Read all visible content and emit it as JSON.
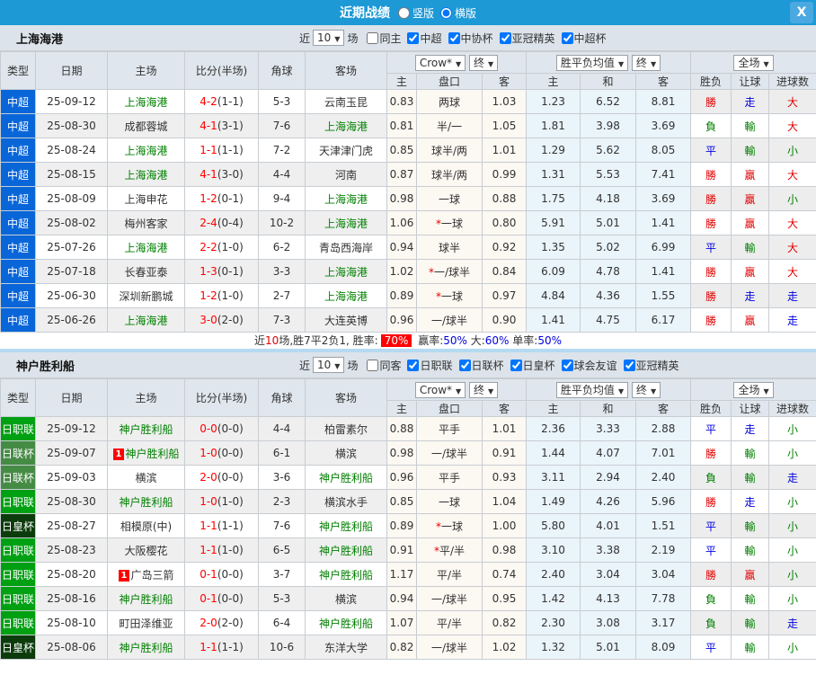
{
  "titlebar": {
    "title": "近期战绩",
    "view_options": [
      {
        "label": "竖版",
        "checked": false
      },
      {
        "label": "横版",
        "checked": true
      }
    ],
    "close_label": "X"
  },
  "filter": {
    "near_label": "近",
    "count": "10",
    "games_label": "场"
  },
  "table_header": {
    "main_columns": [
      "类型",
      "日期",
      "主场",
      "比分(半场)",
      "角球",
      "客场"
    ],
    "odds_source_select": "Crow*",
    "odds_time_select": "终",
    "avg_select": "胜平负均值",
    "avg_time_select": "终",
    "scope_select": "全场",
    "odds_sub": [
      "主",
      "盘口",
      "客"
    ],
    "avg_sub": [
      "主",
      "和",
      "客"
    ],
    "result_sub": [
      "胜负",
      "让球",
      "进球数"
    ]
  },
  "colors": {
    "r": "#e10000",
    "g": "#008000",
    "b": "#0000e0",
    "k": "#333333",
    "team": "#008000",
    "score": "#ff0000",
    "badge_bg": "#ff0000",
    "titlebar_bg": "#1d99d6",
    "league": {
      "中超": "#0866d9",
      "日职联": "#00a013",
      "日联杯": "#458b45",
      "日皇杯": "#0c3c0c"
    }
  },
  "sections": [
    {
      "team": "上海海港",
      "venue_filter": {
        "label": "同主",
        "checked": false
      },
      "league_filters": [
        {
          "label": "中超",
          "checked": true
        },
        {
          "label": "中协杯",
          "checked": true
        },
        {
          "label": "亚冠精英",
          "checked": true
        },
        {
          "label": "中超杯",
          "checked": true
        }
      ],
      "rows": [
        {
          "league": "中超",
          "date": "25-09-12",
          "home": "上海海港",
          "home_hl": true,
          "home_badge": "",
          "score": "4-2",
          "half": "(1-1)",
          "corners": "5-3",
          "away": "云南玉昆",
          "away_hl": false,
          "away_badge": "",
          "o_home": "0.83",
          "handicap": "两球",
          "star": false,
          "o_away": "1.03",
          "avg_home": "1.23",
          "avg_draw": "6.52",
          "avg_away": "8.81",
          "wdl": "勝",
          "wdl_c": "r",
          "let": "走",
          "let_c": "b",
          "goal": "大",
          "goal_c": "r",
          "shaded": false
        },
        {
          "league": "中超",
          "date": "25-08-30",
          "home": "成都蓉城",
          "home_hl": false,
          "home_badge": "",
          "score": "4-1",
          "half": "(3-1)",
          "corners": "7-6",
          "away": "上海海港",
          "away_hl": true,
          "away_badge": "",
          "o_home": "0.81",
          "handicap": "半/一",
          "star": false,
          "o_away": "1.05",
          "avg_home": "1.81",
          "avg_draw": "3.98",
          "avg_away": "3.69",
          "wdl": "負",
          "wdl_c": "g",
          "let": "輸",
          "let_c": "g",
          "goal": "大",
          "goal_c": "r",
          "shaded": true
        },
        {
          "league": "中超",
          "date": "25-08-24",
          "home": "上海海港",
          "home_hl": true,
          "home_badge": "",
          "score": "1-1",
          "half": "(1-1)",
          "corners": "7-2",
          "away": "天津津门虎",
          "away_hl": false,
          "away_badge": "",
          "o_home": "0.85",
          "handicap": "球半/两",
          "star": false,
          "o_away": "1.01",
          "avg_home": "1.29",
          "avg_draw": "5.62",
          "avg_away": "8.05",
          "wdl": "平",
          "wdl_c": "b",
          "let": "輸",
          "let_c": "g",
          "goal": "小",
          "goal_c": "g",
          "shaded": false
        },
        {
          "league": "中超",
          "date": "25-08-15",
          "home": "上海海港",
          "home_hl": true,
          "home_badge": "",
          "score": "4-1",
          "half": "(3-0)",
          "corners": "4-4",
          "away": "河南",
          "away_hl": false,
          "away_badge": "",
          "o_home": "0.87",
          "handicap": "球半/两",
          "star": false,
          "o_away": "0.99",
          "avg_home": "1.31",
          "avg_draw": "5.53",
          "avg_away": "7.41",
          "wdl": "勝",
          "wdl_c": "r",
          "let": "贏",
          "let_c": "r",
          "goal": "大",
          "goal_c": "r",
          "shaded": true
        },
        {
          "league": "中超",
          "date": "25-08-09",
          "home": "上海申花",
          "home_hl": false,
          "home_badge": "",
          "score": "1-2",
          "half": "(0-1)",
          "corners": "9-4",
          "away": "上海海港",
          "away_hl": true,
          "away_badge": "",
          "o_home": "0.98",
          "handicap": "一球",
          "star": false,
          "o_away": "0.88",
          "avg_home": "1.75",
          "avg_draw": "4.18",
          "avg_away": "3.69",
          "wdl": "勝",
          "wdl_c": "r",
          "let": "贏",
          "let_c": "r",
          "goal": "小",
          "goal_c": "g",
          "shaded": false
        },
        {
          "league": "中超",
          "date": "25-08-02",
          "home": "梅州客家",
          "home_hl": false,
          "home_badge": "",
          "score": "2-4",
          "half": "(0-4)",
          "corners": "10-2",
          "away": "上海海港",
          "away_hl": true,
          "away_badge": "",
          "o_home": "1.06",
          "handicap": "一球",
          "star": true,
          "o_away": "0.80",
          "avg_home": "5.91",
          "avg_draw": "5.01",
          "avg_away": "1.41",
          "wdl": "勝",
          "wdl_c": "r",
          "let": "贏",
          "let_c": "r",
          "goal": "大",
          "goal_c": "r",
          "shaded": true
        },
        {
          "league": "中超",
          "date": "25-07-26",
          "home": "上海海港",
          "home_hl": true,
          "home_badge": "",
          "score": "2-2",
          "half": "(1-0)",
          "corners": "6-2",
          "away": "青岛西海岸",
          "away_hl": false,
          "away_badge": "",
          "o_home": "0.94",
          "handicap": "球半",
          "star": false,
          "o_away": "0.92",
          "avg_home": "1.35",
          "avg_draw": "5.02",
          "avg_away": "6.99",
          "wdl": "平",
          "wdl_c": "b",
          "let": "輸",
          "let_c": "g",
          "goal": "大",
          "goal_c": "r",
          "shaded": false
        },
        {
          "league": "中超",
          "date": "25-07-18",
          "home": "长春亚泰",
          "home_hl": false,
          "home_badge": "",
          "score": "1-3",
          "half": "(0-1)",
          "corners": "3-3",
          "away": "上海海港",
          "away_hl": true,
          "away_badge": "",
          "o_home": "1.02",
          "handicap": "一/球半",
          "star": true,
          "o_away": "0.84",
          "avg_home": "6.09",
          "avg_draw": "4.78",
          "avg_away": "1.41",
          "wdl": "勝",
          "wdl_c": "r",
          "let": "贏",
          "let_c": "r",
          "goal": "大",
          "goal_c": "r",
          "shaded": true
        },
        {
          "league": "中超",
          "date": "25-06-30",
          "home": "深圳新鹏城",
          "home_hl": false,
          "home_badge": "",
          "score": "1-2",
          "half": "(1-0)",
          "corners": "2-7",
          "away": "上海海港",
          "away_hl": true,
          "away_badge": "",
          "o_home": "0.89",
          "handicap": "一球",
          "star": true,
          "o_away": "0.97",
          "avg_home": "4.84",
          "avg_draw": "4.36",
          "avg_away": "1.55",
          "wdl": "勝",
          "wdl_c": "r",
          "let": "走",
          "let_c": "b",
          "goal": "走",
          "goal_c": "b",
          "shaded": false
        },
        {
          "league": "中超",
          "date": "25-06-26",
          "home": "上海海港",
          "home_hl": true,
          "home_badge": "",
          "score": "3-0",
          "half": "(2-0)",
          "corners": "7-3",
          "away": "大连英博",
          "away_hl": false,
          "away_badge": "",
          "o_home": "0.96",
          "handicap": "一/球半",
          "star": false,
          "o_away": "0.90",
          "avg_home": "1.41",
          "avg_draw": "4.75",
          "avg_away": "6.17",
          "wdl": "勝",
          "wdl_c": "r",
          "let": "贏",
          "let_c": "r",
          "goal": "走",
          "goal_c": "b",
          "shaded": true
        }
      ],
      "summary": [
        {
          "text": "近",
          "style": "k"
        },
        {
          "text": "10",
          "style": "r"
        },
        {
          "text": "场,胜7平2负1, 胜率:",
          "style": "k"
        },
        {
          "text": "70%",
          "style": "badge"
        },
        {
          "text": " 赢率:",
          "style": "k"
        },
        {
          "text": "50%",
          "style": "b"
        },
        {
          "text": " 大:",
          "style": "k"
        },
        {
          "text": "60%",
          "style": "b"
        },
        {
          "text": " 单率:",
          "style": "k"
        },
        {
          "text": "50%",
          "style": "b"
        }
      ]
    },
    {
      "team": "神户胜利船",
      "venue_filter": {
        "label": "同客",
        "checked": false
      },
      "league_filters": [
        {
          "label": "日职联",
          "checked": true
        },
        {
          "label": "日联杯",
          "checked": true
        },
        {
          "label": "日皇杯",
          "checked": true
        },
        {
          "label": "球会友谊",
          "checked": true
        },
        {
          "label": "亚冠精英",
          "checked": true
        }
      ],
      "rows": [
        {
          "league": "日职联",
          "date": "25-09-12",
          "home": "神户胜利船",
          "home_hl": true,
          "home_badge": "",
          "score": "0-0",
          "half": "(0-0)",
          "corners": "4-4",
          "away": "柏雷素尔",
          "away_hl": false,
          "away_badge": "",
          "o_home": "0.88",
          "handicap": "平手",
          "star": false,
          "o_away": "1.01",
          "avg_home": "2.36",
          "avg_draw": "3.33",
          "avg_away": "2.88",
          "wdl": "平",
          "wdl_c": "b",
          "let": "走",
          "let_c": "b",
          "goal": "小",
          "goal_c": "g",
          "shaded": true
        },
        {
          "league": "日联杯",
          "date": "25-09-07",
          "home": "神户胜利船",
          "home_hl": true,
          "home_badge": "1",
          "score": "1-0",
          "half": "(0-0)",
          "corners": "6-1",
          "away": "横滨",
          "away_hl": false,
          "away_badge": "",
          "o_home": "0.98",
          "handicap": "一/球半",
          "star": false,
          "o_away": "0.91",
          "avg_home": "1.44",
          "avg_draw": "4.07",
          "avg_away": "7.01",
          "wdl": "勝",
          "wdl_c": "r",
          "let": "輸",
          "let_c": "g",
          "goal": "小",
          "goal_c": "g",
          "shaded": true
        },
        {
          "league": "日联杯",
          "date": "25-09-03",
          "home": "横滨",
          "home_hl": false,
          "home_badge": "",
          "score": "2-0",
          "half": "(0-0)",
          "corners": "3-6",
          "away": "神户胜利船",
          "away_hl": true,
          "away_badge": "",
          "o_home": "0.96",
          "handicap": "平手",
          "star": false,
          "o_away": "0.93",
          "avg_home": "3.11",
          "avg_draw": "2.94",
          "avg_away": "2.40",
          "wdl": "負",
          "wdl_c": "g",
          "let": "輸",
          "let_c": "g",
          "goal": "走",
          "goal_c": "b",
          "shaded": false
        },
        {
          "league": "日职联",
          "date": "25-08-30",
          "home": "神户胜利船",
          "home_hl": true,
          "home_badge": "",
          "score": "1-0",
          "half": "(1-0)",
          "corners": "2-3",
          "away": "横滨水手",
          "away_hl": false,
          "away_badge": "",
          "o_home": "0.85",
          "handicap": "一球",
          "star": false,
          "o_away": "1.04",
          "avg_home": "1.49",
          "avg_draw": "4.26",
          "avg_away": "5.96",
          "wdl": "勝",
          "wdl_c": "r",
          "let": "走",
          "let_c": "b",
          "goal": "小",
          "goal_c": "g",
          "shaded": true
        },
        {
          "league": "日皇杯",
          "date": "25-08-27",
          "home": "相模原(中)",
          "home_hl": false,
          "home_badge": "",
          "score": "1-1",
          "half": "(1-1)",
          "corners": "7-6",
          "away": "神户胜利船",
          "away_hl": true,
          "away_badge": "",
          "o_home": "0.89",
          "handicap": "一球",
          "star": true,
          "o_away": "1.00",
          "avg_home": "5.80",
          "avg_draw": "4.01",
          "avg_away": "1.51",
          "wdl": "平",
          "wdl_c": "b",
          "let": "輸",
          "let_c": "g",
          "goal": "小",
          "goal_c": "g",
          "shaded": false
        },
        {
          "league": "日职联",
          "date": "25-08-23",
          "home": "大阪樱花",
          "home_hl": false,
          "home_badge": "",
          "score": "1-1",
          "half": "(1-0)",
          "corners": "6-5",
          "away": "神户胜利船",
          "away_hl": true,
          "away_badge": "",
          "o_home": "0.91",
          "handicap": "平/半",
          "star": true,
          "o_away": "0.98",
          "avg_home": "3.10",
          "avg_draw": "3.38",
          "avg_away": "2.19",
          "wdl": "平",
          "wdl_c": "b",
          "let": "輸",
          "let_c": "g",
          "goal": "小",
          "goal_c": "g",
          "shaded": true
        },
        {
          "league": "日职联",
          "date": "25-08-20",
          "home": "广岛三箭",
          "home_hl": false,
          "home_badge": "1",
          "score": "0-1",
          "half": "(0-0)",
          "corners": "3-7",
          "away": "神户胜利船",
          "away_hl": true,
          "away_badge": "",
          "o_home": "1.17",
          "handicap": "平/半",
          "star": false,
          "o_away": "0.74",
          "avg_home": "2.40",
          "avg_draw": "3.04",
          "avg_away": "3.04",
          "wdl": "勝",
          "wdl_c": "r",
          "let": "贏",
          "let_c": "r",
          "goal": "小",
          "goal_c": "g",
          "shaded": false
        },
        {
          "league": "日职联",
          "date": "25-08-16",
          "home": "神户胜利船",
          "home_hl": true,
          "home_badge": "",
          "score": "0-1",
          "half": "(0-0)",
          "corners": "5-3",
          "away": "横滨",
          "away_hl": false,
          "away_badge": "",
          "o_home": "0.94",
          "handicap": "一/球半",
          "star": false,
          "o_away": "0.95",
          "avg_home": "1.42",
          "avg_draw": "4.13",
          "avg_away": "7.78",
          "wdl": "負",
          "wdl_c": "g",
          "let": "輸",
          "let_c": "g",
          "goal": "小",
          "goal_c": "g",
          "shaded": true
        },
        {
          "league": "日职联",
          "date": "25-08-10",
          "home": "町田泽维亚",
          "home_hl": false,
          "home_badge": "",
          "score": "2-0",
          "half": "(2-0)",
          "corners": "6-4",
          "away": "神户胜利船",
          "away_hl": true,
          "away_badge": "",
          "o_home": "1.07",
          "handicap": "平/半",
          "star": false,
          "o_away": "0.82",
          "avg_home": "2.30",
          "avg_draw": "3.08",
          "avg_away": "3.17",
          "wdl": "負",
          "wdl_c": "g",
          "let": "輸",
          "let_c": "g",
          "goal": "走",
          "goal_c": "b",
          "shaded": false
        },
        {
          "league": "日皇杯",
          "date": "25-08-06",
          "home": "神户胜利船",
          "home_hl": true,
          "home_badge": "",
          "score": "1-1",
          "half": "(1-1)",
          "corners": "10-6",
          "away": "东洋大学",
          "away_hl": false,
          "away_badge": "",
          "o_home": "0.82",
          "handicap": "一/球半",
          "star": false,
          "o_away": "1.02",
          "avg_home": "1.32",
          "avg_draw": "5.01",
          "avg_away": "8.09",
          "wdl": "平",
          "wdl_c": "b",
          "let": "輸",
          "let_c": "g",
          "goal": "小",
          "goal_c": "g",
          "shaded": true
        }
      ],
      "summary": null
    }
  ]
}
